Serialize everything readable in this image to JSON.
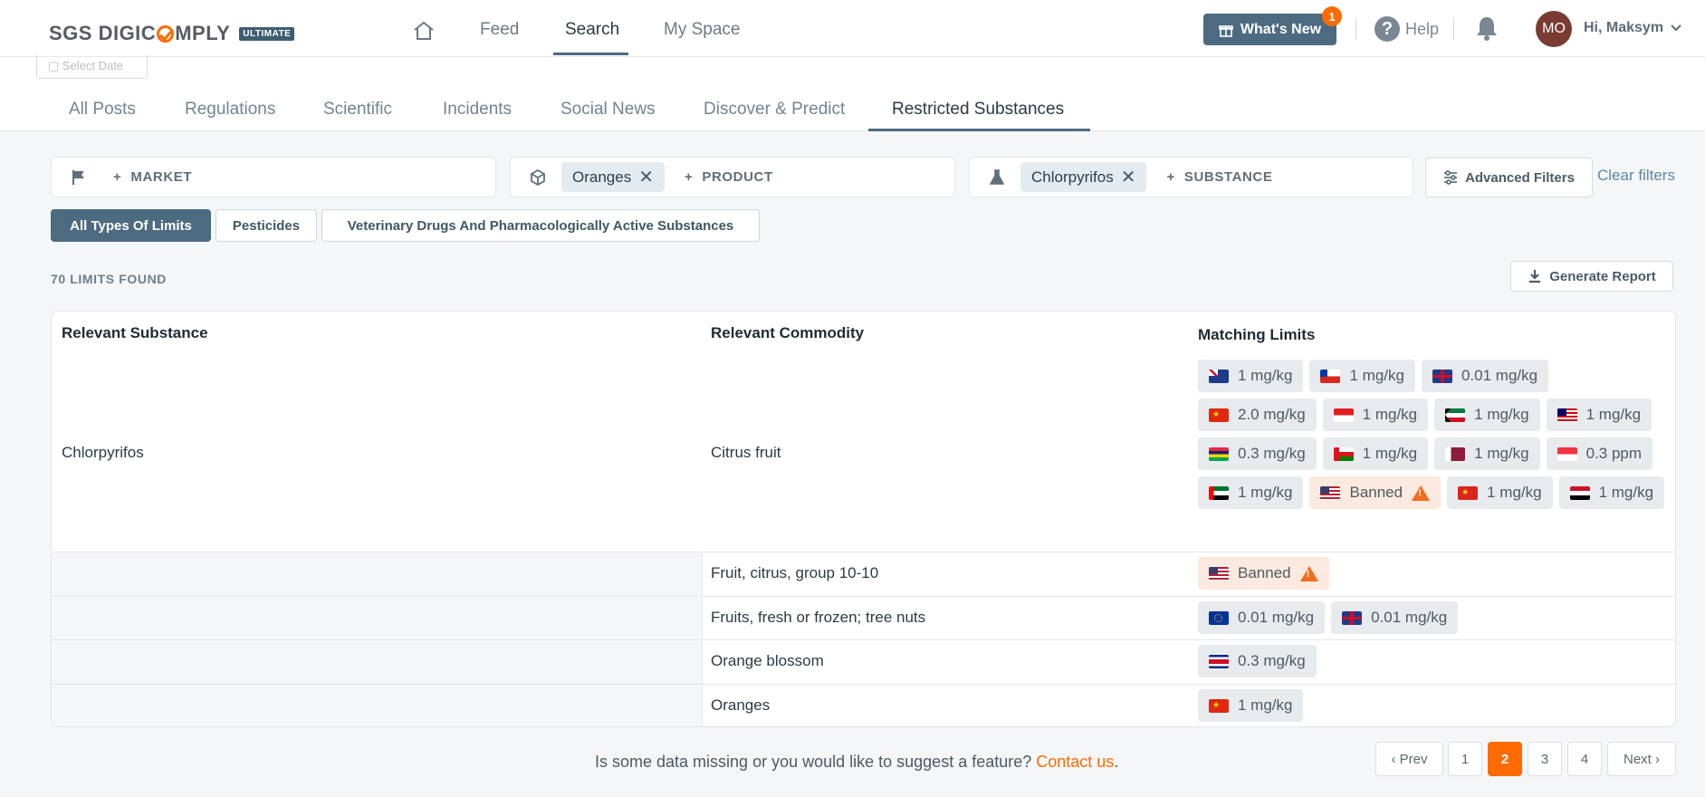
{
  "header": {
    "logo_text_1": "SGS DIGIC",
    "logo_text_2": "MPLY",
    "logo_badge": "ULTIMATE",
    "nav": [
      "Feed",
      "Search",
      "My Space"
    ],
    "whats_new": "What's New",
    "whats_new_count": "1",
    "help": "Help",
    "help_glyph": "?",
    "avatar_initials": "MO",
    "greeting": "Hi, Maksym"
  },
  "subtabs": {
    "select_date": "Select Date",
    "items": [
      "All Posts",
      "Regulations",
      "Scientific",
      "Incidents",
      "Social News",
      "Discover & Predict",
      "Restricted Substances"
    ],
    "active": "Restricted Substances"
  },
  "filters": {
    "market_label": "MARKET",
    "product_chip": "Oranges",
    "product_label": "PRODUCT",
    "substance_chip": "Chlorpyrifos",
    "substance_label": "SUBSTANCE",
    "advanced": "Advanced Filters",
    "clear": "Clear filters",
    "limit_types": [
      "All Types Of Limits",
      "Pesticides",
      "Veterinary Drugs And Pharmacologically Active Substances"
    ],
    "limit_types_active": "All Types Of Limits"
  },
  "results": {
    "count": "70 LIMITS FOUND",
    "generate_report": "Generate Report"
  },
  "table": {
    "headers": [
      "Relevant Substance",
      "Relevant Commodity",
      "Matching Limits"
    ],
    "rows": [
      {
        "substance": "Chlorpyrifos",
        "commodity": "Citrus fruit",
        "limits": [
          {
            "flag": "AU",
            "value": "1 mg/kg"
          },
          {
            "flag": "CL",
            "value": "1 mg/kg"
          },
          {
            "flag": "GB",
            "value": "0.01 mg/kg"
          },
          {
            "flag": "HK",
            "value": "2.0 mg/kg"
          },
          {
            "flag": "ID",
            "value": "1 mg/kg"
          },
          {
            "flag": "KW",
            "value": "1 mg/kg"
          },
          {
            "flag": "MY",
            "value": "1 mg/kg"
          },
          {
            "flag": "MU",
            "value": "0.3 mg/kg"
          },
          {
            "flag": "OM",
            "value": "1 mg/kg"
          },
          {
            "flag": "QA",
            "value": "1 mg/kg"
          },
          {
            "flag": "SG",
            "value": "0.3 ppm"
          },
          {
            "flag": "AE",
            "value": "1 mg/kg"
          },
          {
            "flag": "US",
            "value": "Banned",
            "banned": true
          },
          {
            "flag": "VN",
            "value": "1 mg/kg"
          },
          {
            "flag": "YE",
            "value": "1 mg/kg"
          }
        ]
      },
      {
        "substance": "",
        "commodity": "Fruit, citrus, group 10-10",
        "limits": [
          {
            "flag": "US",
            "value": "Banned",
            "banned": true
          }
        ]
      },
      {
        "substance": "",
        "commodity": "Fruits, fresh or frozen; tree nuts",
        "limits": [
          {
            "flag": "EU",
            "value": "0.01 mg/kg"
          },
          {
            "flag": "GB",
            "value": "0.01 mg/kg"
          }
        ]
      },
      {
        "substance": "",
        "commodity": "Orange blossom",
        "limits": [
          {
            "flag": "CR",
            "value": "0.3 mg/kg"
          }
        ]
      },
      {
        "substance": "",
        "commodity": "Oranges",
        "limits": [
          {
            "flag": "CN",
            "value": "1 mg/kg"
          }
        ]
      }
    ]
  },
  "footer": {
    "text": "Is some data missing or you would like to suggest a feature? ",
    "link": "Contact us",
    "period": "."
  },
  "pagination": {
    "prev": "Prev",
    "pages": [
      "1",
      "2",
      "3",
      "4"
    ],
    "current": "2",
    "next": "Next"
  },
  "colors": {
    "accent": "#4d6b80",
    "brand_orange": "#ff6b00",
    "banned_bg": "#fce9df",
    "warning": "#f26b1d"
  }
}
